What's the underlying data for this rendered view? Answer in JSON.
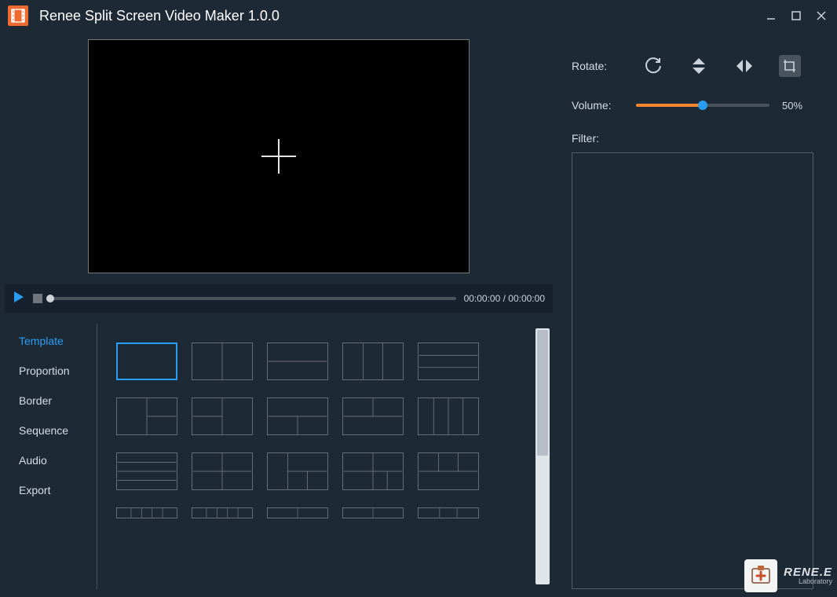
{
  "app": {
    "title": "Renee Split Screen Video Maker 1.0.0"
  },
  "playback": {
    "time": "00:00:00 / 00:00:00"
  },
  "tabs": [
    {
      "label": "Template",
      "active": true
    },
    {
      "label": "Proportion",
      "active": false
    },
    {
      "label": "Border",
      "active": false
    },
    {
      "label": "Sequence",
      "active": false
    },
    {
      "label": "Audio",
      "active": false
    },
    {
      "label": "Export",
      "active": false
    }
  ],
  "right": {
    "rotate_label": "Rotate:",
    "volume_label": "Volume:",
    "volume_value": "50%",
    "filter_label": "Filter:"
  },
  "brand": {
    "name": "RENE.E",
    "sub": "Laboratory"
  }
}
